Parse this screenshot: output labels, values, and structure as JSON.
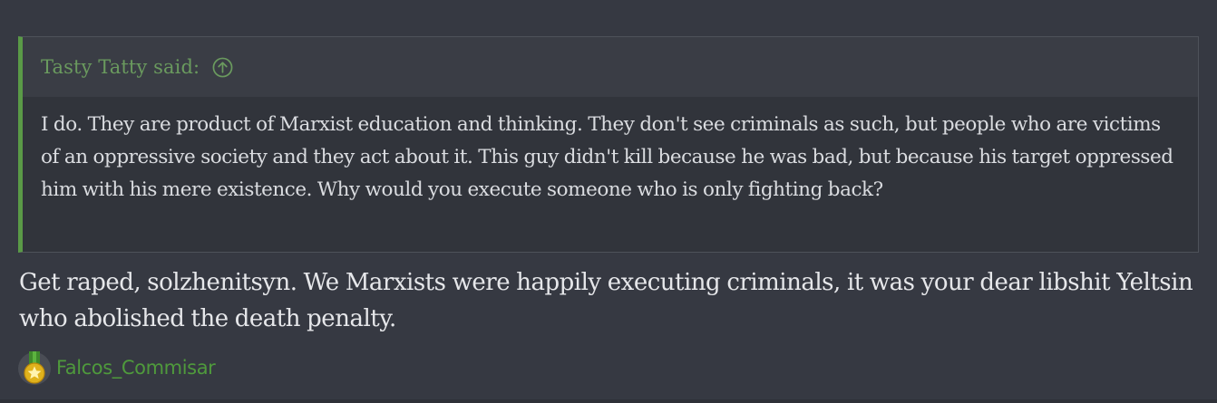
{
  "quote": {
    "author_line": "Tasty Tatty said:",
    "jump_icon": "arrow-up-circle-icon",
    "text": "I do. They are product of Marxist education and thinking. They don't see criminals as such, but people who are victims of an oppressive society and they act about it. This guy didn't kill because he was bad, but because his target oppressed him with his mere existence. Why would you execute someone who is only fighting back?"
  },
  "reply": {
    "text": "Get raped, solzhenitsyn. We Marxists were happily executing criminals, it was your dear libshit Yeltsin who abolished the death penalty."
  },
  "signature": {
    "icon": "medal-icon",
    "name": "Falcos_Commisar"
  },
  "colors": {
    "background": "#363942",
    "quote_accent": "#5a9a47",
    "quote_author": "#6a9a5e",
    "signature_link": "#4f9a3c"
  }
}
